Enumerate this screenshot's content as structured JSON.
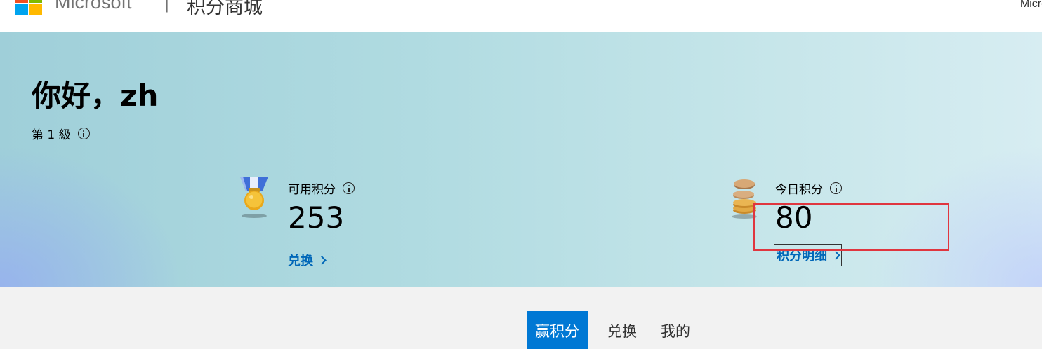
{
  "header": {
    "brand": "Microsoft",
    "separator": "|",
    "site_title": "积分商城",
    "right_text": "Micro"
  },
  "hero": {
    "greeting": "你好，zh",
    "level": "第 1 級",
    "available_points": {
      "label": "可用积分",
      "value": "253",
      "link": "兑换"
    },
    "today_points": {
      "label": "今日积分",
      "value": "80",
      "link": "积分明细"
    }
  },
  "tabs": [
    {
      "label": "赢积分",
      "active": true
    },
    {
      "label": "兑换",
      "active": false
    },
    {
      "label": "我的",
      "active": false
    }
  ],
  "colors": {
    "accent": "#0078d4",
    "link": "#0067b8",
    "highlight": "#e0363f"
  },
  "icons": {
    "logo": "microsoft-logo",
    "medal": "medal-icon",
    "coins": "coins-icon",
    "info": "info-icon",
    "chevron": "chevron-right-icon"
  }
}
